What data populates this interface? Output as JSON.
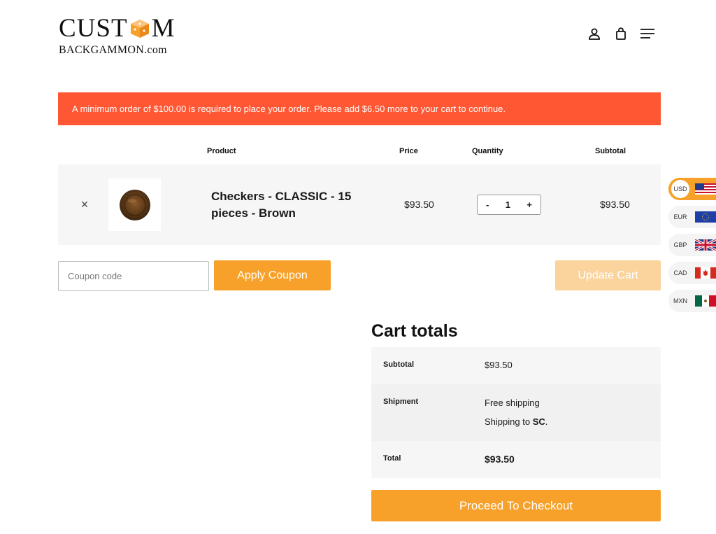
{
  "brand": {
    "logo_top_left": "CUST",
    "logo_top_right": "M",
    "logo_bottom": "BACKGAMMON.com"
  },
  "notice": {
    "text": "A minimum order of $100.00 is required to place your order. Please add $6.50 more to your cart to continue."
  },
  "table": {
    "headers": {
      "product": "Product",
      "price": "Price",
      "quantity": "Quantity",
      "subtotal": "Subtotal"
    },
    "items": [
      {
        "remove": "×",
        "name": "Checkers - CLASSIC - 15 pieces - Brown",
        "price": "$93.50",
        "qty_minus": "-",
        "qty": "1",
        "qty_plus": "+",
        "subtotal": "$93.50"
      }
    ]
  },
  "coupon": {
    "placeholder": "Coupon code",
    "apply_label": "Apply Coupon",
    "update_label": "Update Cart"
  },
  "totals": {
    "title": "Cart totals",
    "subtotal_label": "Subtotal",
    "subtotal_value": "$93.50",
    "shipment_label": "Shipment",
    "shipment_method": "Free shipping",
    "shipping_to_prefix": "Shipping to",
    "shipping_to_state": "SC",
    "total_label": "Total",
    "total_value": "$93.50",
    "checkout_label": "Proceed To Checkout"
  },
  "currencies": [
    {
      "code": "USD",
      "active": true
    },
    {
      "code": "EUR",
      "active": false
    },
    {
      "code": "GBP",
      "active": false
    },
    {
      "code": "CAD",
      "active": false
    },
    {
      "code": "MXN",
      "active": false
    }
  ],
  "colors": {
    "accent": "#f7a12a",
    "accent_disabled": "#fbd39c",
    "notice": "#ff5733",
    "row_bg": "#f6f6f6"
  }
}
